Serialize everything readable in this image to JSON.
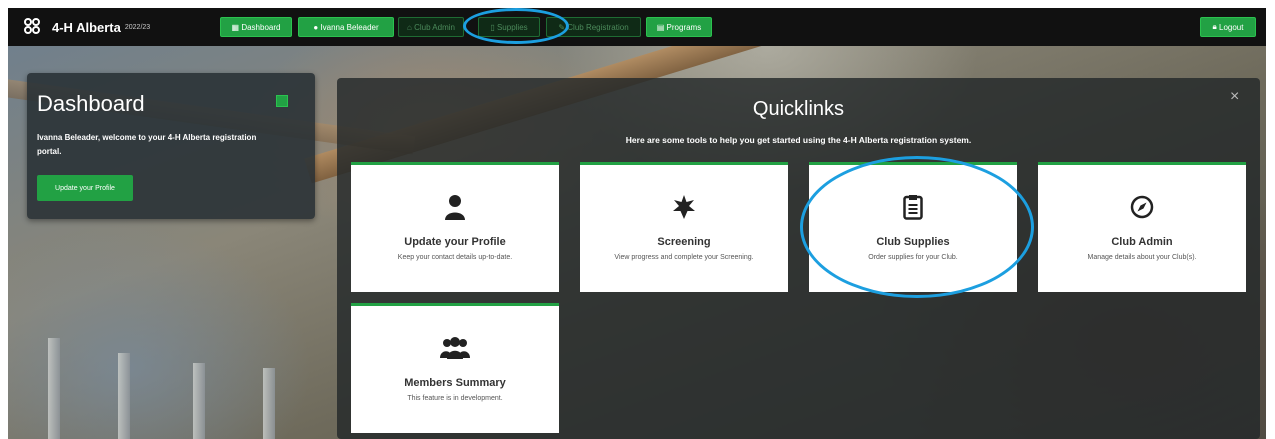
{
  "navbar": {
    "brand": "4-H Alberta",
    "year": "2022/23",
    "buttons": [
      {
        "label": "Dashboard",
        "icon": "dashboard-icon",
        "state": "active"
      },
      {
        "label": "Ivanna Beleader",
        "icon": "user-icon",
        "state": "active"
      },
      {
        "label": "Club Admin",
        "icon": "home-icon",
        "state": "disabled"
      },
      {
        "label": "Supplies",
        "icon": "clipboard-icon",
        "state": "disabled"
      },
      {
        "label": "Club Registration",
        "icon": "edit-icon",
        "state": "disabled"
      },
      {
        "label": "Programs",
        "icon": "calendar-icon",
        "state": "active"
      }
    ],
    "logout": "Logout"
  },
  "dashboard": {
    "title": "Dashboard",
    "welcome": "Ivanna Beleader, welcome to your 4-H Alberta registration portal.",
    "button": "Update your Profile"
  },
  "quicklinks": {
    "title": "Quicklinks",
    "subtitle": "Here are some tools to help you get started using the 4-H Alberta registration system.",
    "close": "×",
    "tiles": [
      {
        "name": "Update your Profile",
        "desc": "Keep your contact details up-to-date.",
        "icon": "user-icon"
      },
      {
        "name": "Screening",
        "desc": "View progress and complete your Screening.",
        "icon": "star-badge-icon"
      },
      {
        "name": "Club Supplies",
        "desc": "Order supplies for your Club.",
        "icon": "clipboard-icon"
      },
      {
        "name": "Club Admin",
        "desc": "Manage details about your Club(s).",
        "icon": "compass-icon"
      },
      {
        "name": "Members Summary",
        "desc": "This feature is in development.",
        "icon": "group-icon"
      }
    ]
  },
  "colors": {
    "accent": "#22a144",
    "navbar": "#111111",
    "callout": "#1c9fe0"
  }
}
